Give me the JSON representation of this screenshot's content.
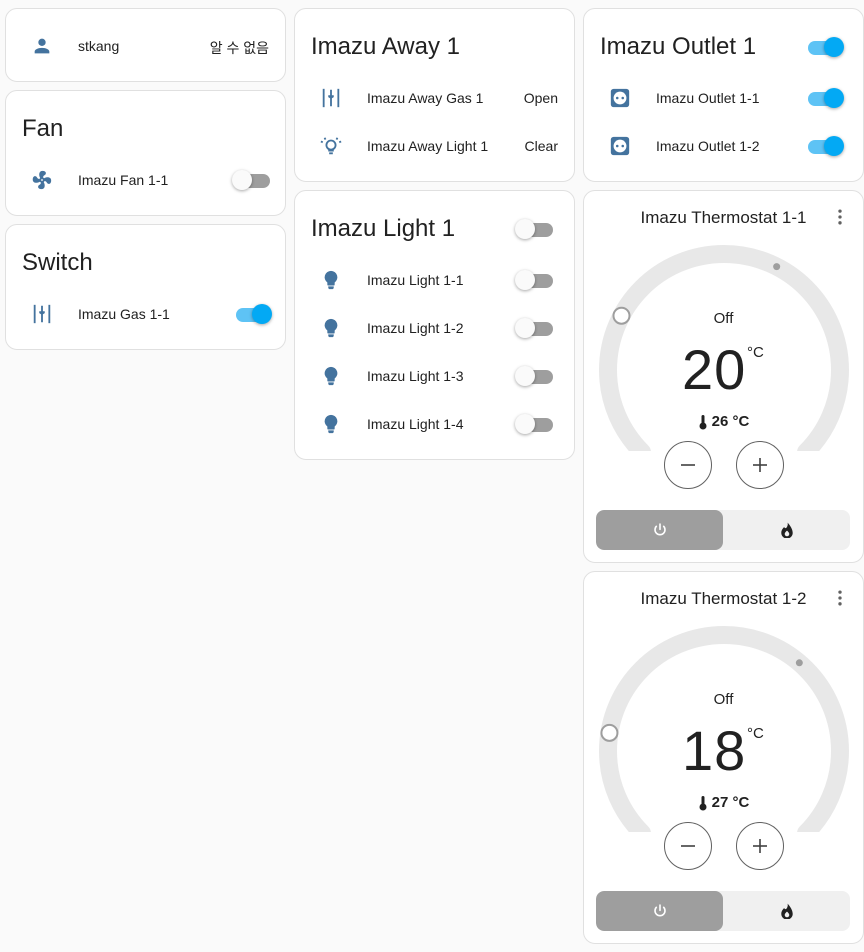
{
  "colors": {
    "accent": "#03a9f4",
    "icon_blue": "#44739e",
    "toggle_off": "#9e9e9e",
    "card_border": "#e0e0e0"
  },
  "person_card": {
    "icon": "account-icon",
    "name": "stkang",
    "state": "알 수 없음"
  },
  "fan_card": {
    "title": "Fan",
    "rows": [
      {
        "icon": "fan-icon",
        "label": "Imazu Fan 1-1",
        "on": false
      }
    ]
  },
  "switch_card": {
    "title": "Switch",
    "rows": [
      {
        "icon": "gas-valve-icon",
        "label": "Imazu Gas 1-1",
        "on": true
      }
    ]
  },
  "away_card": {
    "title": "Imazu Away 1",
    "rows": [
      {
        "icon": "gas-valve-icon",
        "label": "Imazu Away Gas 1",
        "state": "Open"
      },
      {
        "icon": "light-alert-icon",
        "label": "Imazu Away Light 1",
        "state": "Clear"
      }
    ]
  },
  "light_card": {
    "title": "Imazu Light 1",
    "header_on": false,
    "rows": [
      {
        "icon": "lightbulb-icon",
        "label": "Imazu Light 1-1",
        "on": false
      },
      {
        "icon": "lightbulb-icon",
        "label": "Imazu Light 1-2",
        "on": false
      },
      {
        "icon": "lightbulb-icon",
        "label": "Imazu Light 1-3",
        "on": false
      },
      {
        "icon": "lightbulb-icon",
        "label": "Imazu Light 1-4",
        "on": false
      }
    ]
  },
  "outlet_card": {
    "title": "Imazu Outlet 1",
    "header_on": true,
    "rows": [
      {
        "icon": "power-socket-icon",
        "label": "Imazu Outlet 1-1",
        "on": true
      },
      {
        "icon": "power-socket-icon",
        "label": "Imazu Outlet 1-2",
        "on": true
      }
    ]
  },
  "thermostats": [
    {
      "name": "Imazu Thermostat 1-1",
      "hvac_state": "Off",
      "target": "20",
      "unit": "°C",
      "current": "26 °C",
      "target_fraction": 0.27,
      "current_fraction": 0.6,
      "modes": [
        "power-icon",
        "fire-icon"
      ],
      "active_mode": 0
    },
    {
      "name": "Imazu Thermostat 1-2",
      "hvac_state": "Off",
      "target": "18",
      "unit": "°C",
      "current": "27 °C",
      "target_fraction": 0.2,
      "current_fraction": 0.65,
      "modes": [
        "power-icon",
        "fire-icon"
      ],
      "active_mode": 0
    }
  ]
}
